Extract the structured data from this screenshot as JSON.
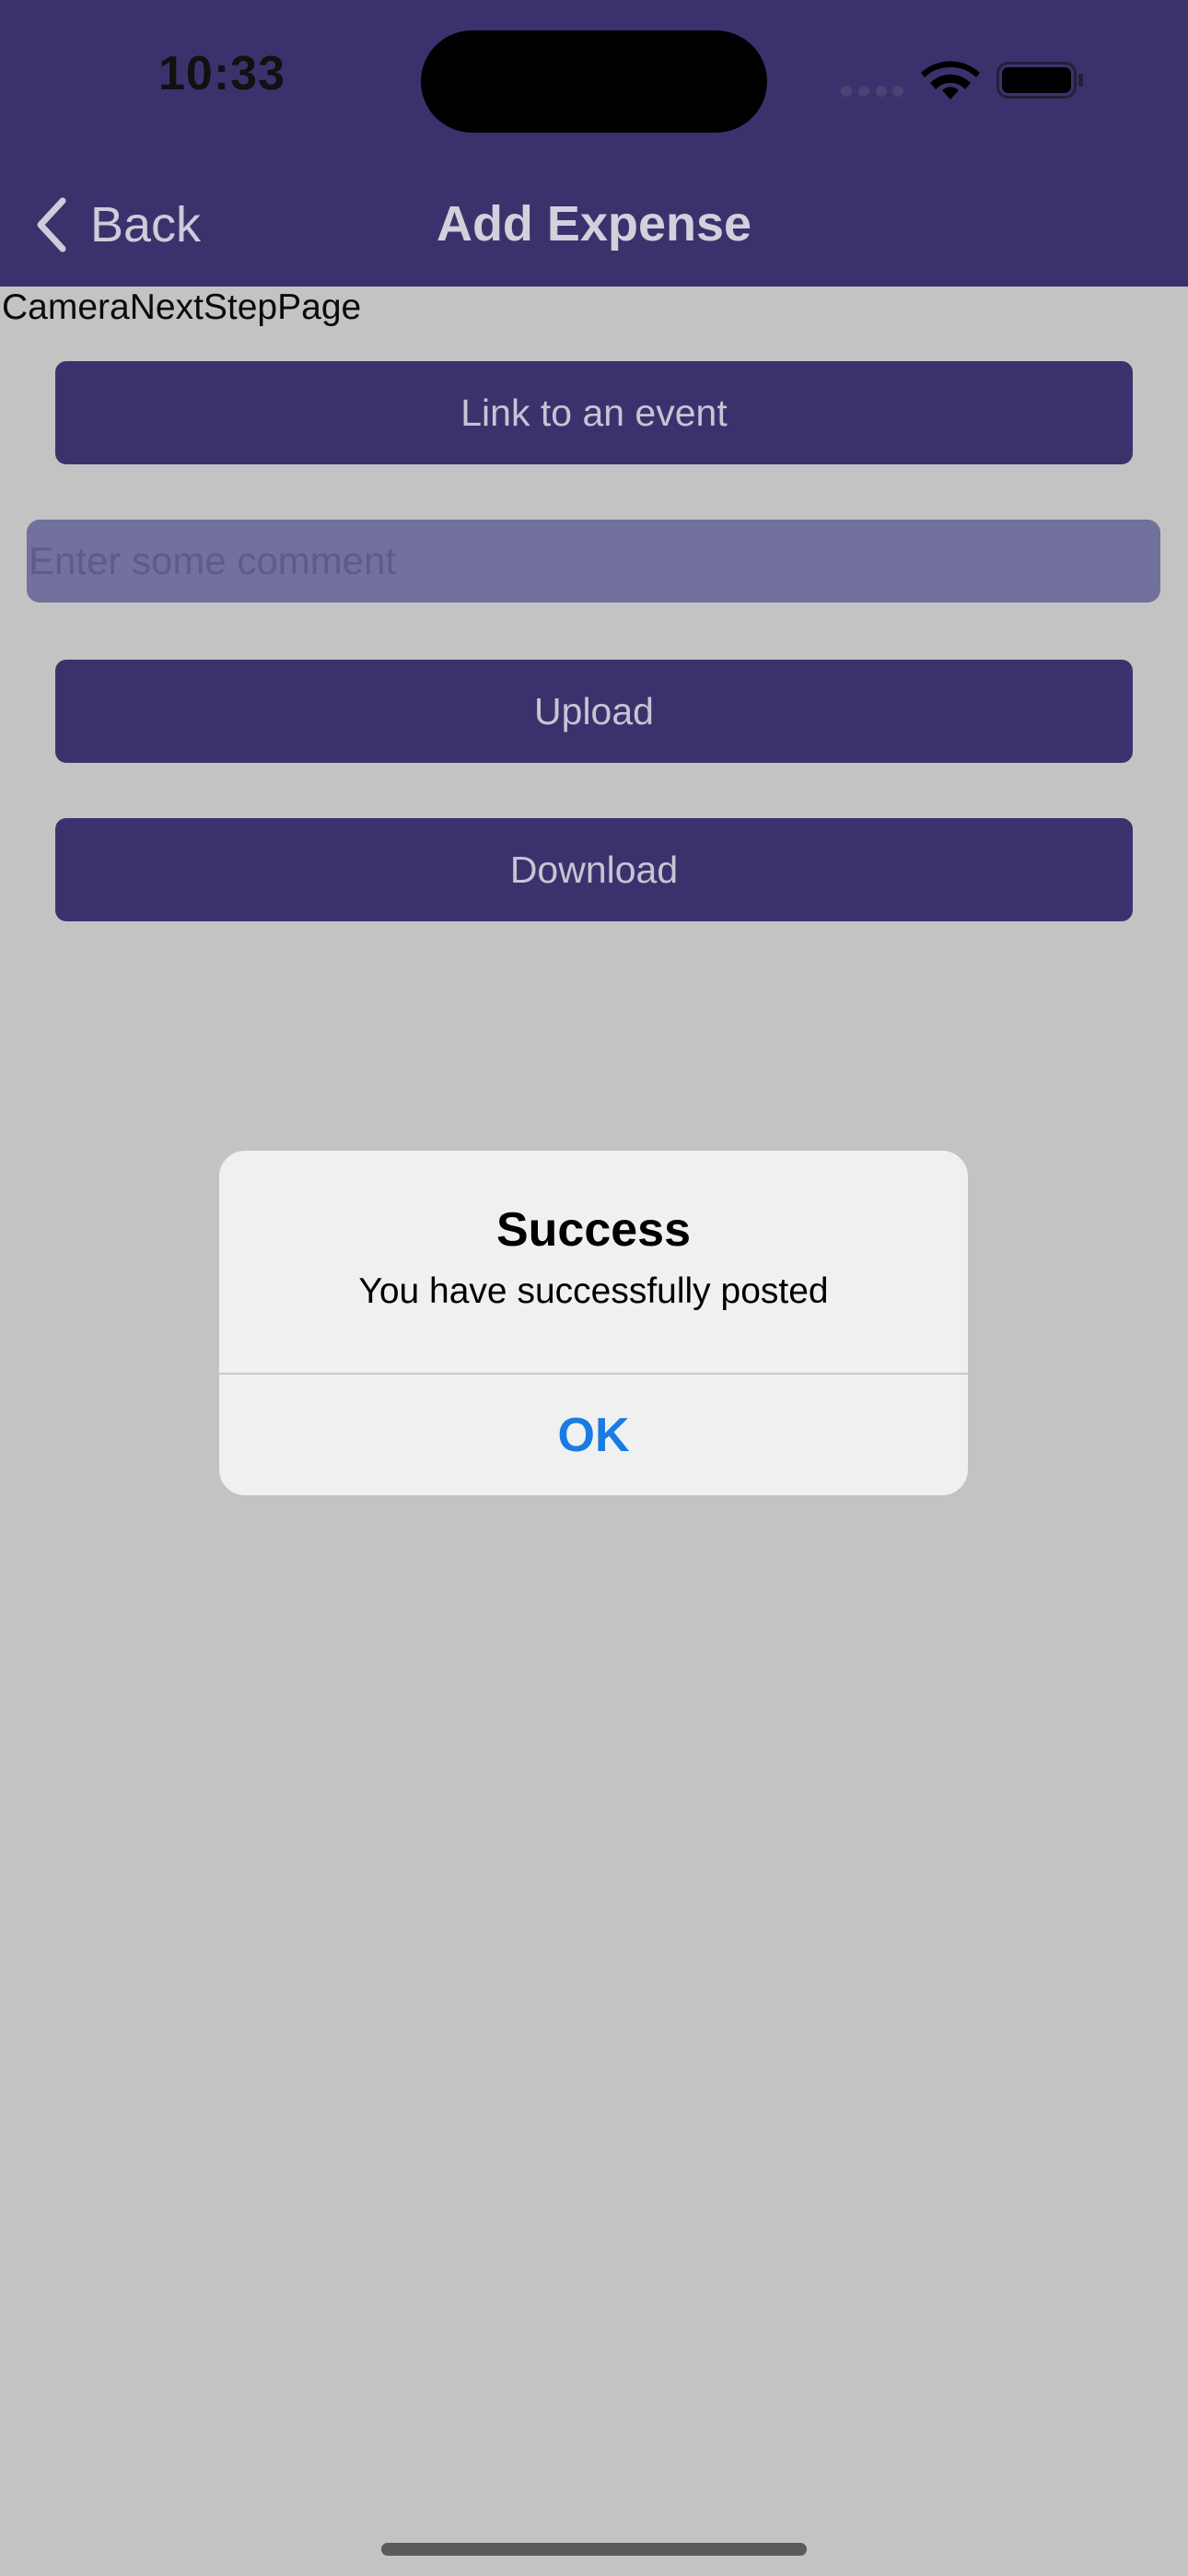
{
  "status_bar": {
    "time": "10:33"
  },
  "nav": {
    "back_label": "Back",
    "title": "Add Expense"
  },
  "page": {
    "name": "CameraNextStepPage",
    "link_event_label": "Link to an event",
    "comment": {
      "value": "",
      "placeholder": "Enter some comment"
    },
    "upload_label": "Upload",
    "download_label": "Download"
  },
  "alert": {
    "title": "Success",
    "message": "You have successfully posted",
    "ok_label": "OK"
  },
  "colors": {
    "header_background": "#3b326d",
    "button_background": "#3b326d",
    "alert_action": "#1a7be0",
    "overlay_background": "#c3c3c3"
  },
  "icons": {
    "back": "chevron-left-icon",
    "wifi": "wifi-icon",
    "battery": "battery-icon",
    "signal": "cellular-signal-icon"
  }
}
